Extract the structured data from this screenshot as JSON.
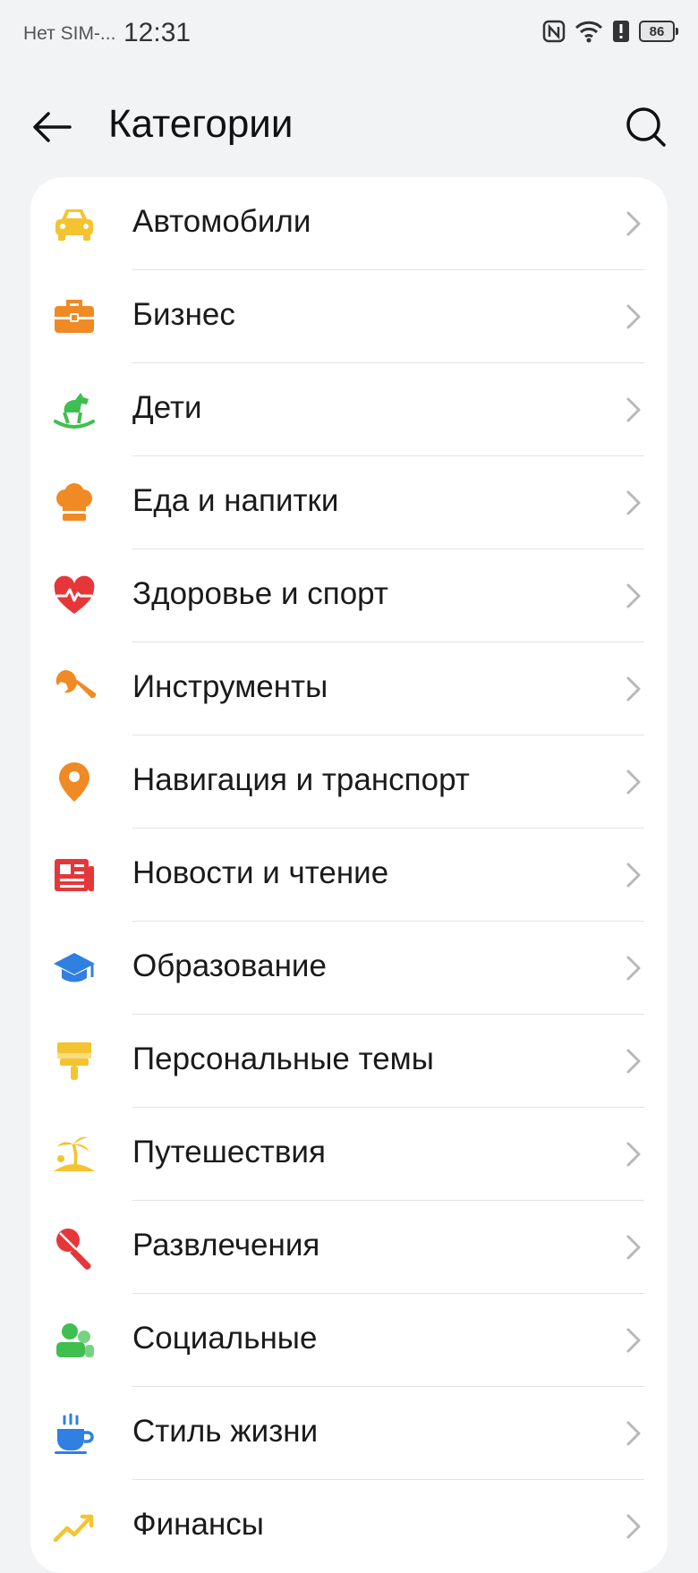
{
  "status_bar": {
    "carrier": "Нет SIM-...",
    "time": "12:31",
    "battery": "86"
  },
  "header": {
    "title": "Категории"
  },
  "categories": [
    {
      "label": "Автомобили",
      "icon": "car-icon",
      "color": "#f4c430"
    },
    {
      "label": "Бизнес",
      "icon": "briefcase-icon",
      "color": "#f08a24"
    },
    {
      "label": "Дети",
      "icon": "rocking-horse-icon",
      "color": "#3fbf4f"
    },
    {
      "label": "Еда и напитки",
      "icon": "chef-hat-icon",
      "color": "#f08a24"
    },
    {
      "label": "Здоровье и спорт",
      "icon": "heart-pulse-icon",
      "color": "#e5373a"
    },
    {
      "label": "Инструменты",
      "icon": "wrench-icon",
      "color": "#f08a24"
    },
    {
      "label": "Навигация и транспорт",
      "icon": "map-pin-icon",
      "color": "#f08a24"
    },
    {
      "label": "Новости и чтение",
      "icon": "newspaper-icon",
      "color": "#e5373a"
    },
    {
      "label": "Образование",
      "icon": "graduation-cap-icon",
      "color": "#2f80e0"
    },
    {
      "label": "Персональные темы",
      "icon": "paint-brush-icon",
      "color": "#f4c430"
    },
    {
      "label": "Путешествия",
      "icon": "palm-island-icon",
      "color": "#f4c430"
    },
    {
      "label": "Развлечения",
      "icon": "microphone-icon",
      "color": "#e5373a"
    },
    {
      "label": "Социальные",
      "icon": "people-icon",
      "color": "#3fbf4f"
    },
    {
      "label": "Стиль жизни",
      "icon": "coffee-cup-icon",
      "color": "#2f80e0"
    },
    {
      "label": "Финансы",
      "icon": "trend-chart-icon",
      "color": "#f4c430"
    }
  ]
}
